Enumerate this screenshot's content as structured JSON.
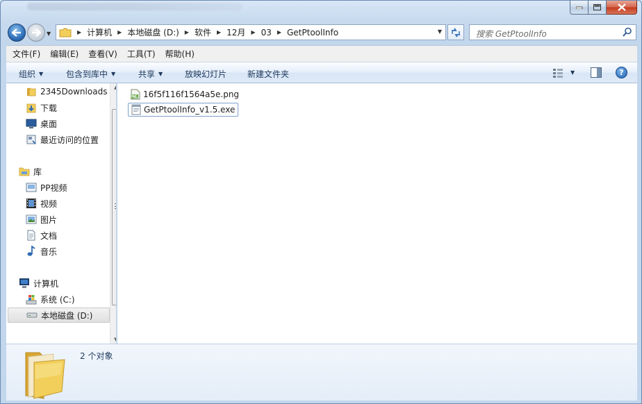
{
  "window": {
    "title_obscured": true
  },
  "address": {
    "breadcrumbs": [
      "计算机",
      "本地磁盘 (D:)",
      "软件",
      "12月",
      "03",
      "GetPtoolInfo"
    ],
    "search_placeholder": "搜索 GetPtoolInfo"
  },
  "menu": {
    "items": [
      "文件(F)",
      "编辑(E)",
      "查看(V)",
      "工具(T)",
      "帮助(H)"
    ]
  },
  "commands": {
    "organize": "组织",
    "include_in_library": "包含到库中",
    "share": "共享",
    "slideshow": "放映幻灯片",
    "new_folder": "新建文件夹"
  },
  "nav": {
    "items": [
      {
        "label": "2345Downloads",
        "icon": "folder-icon"
      },
      {
        "label": "下载",
        "icon": "downloads-icon"
      },
      {
        "label": "桌面",
        "icon": "desktop-icon"
      },
      {
        "label": "最近访问的位置",
        "icon": "recent-places-icon"
      },
      {
        "label": "库",
        "icon": "libraries-icon"
      },
      {
        "label": "PP视频",
        "icon": "pp-video-icon"
      },
      {
        "label": "视频",
        "icon": "video-icon"
      },
      {
        "label": "图片",
        "icon": "pictures-icon"
      },
      {
        "label": "文档",
        "icon": "documents-icon"
      },
      {
        "label": "音乐",
        "icon": "music-icon"
      },
      {
        "label": "计算机",
        "icon": "computer-icon"
      },
      {
        "label": "系统 (C:)",
        "icon": "system-drive-icon"
      },
      {
        "label": "本地磁盘 (D:)",
        "icon": "drive-icon"
      }
    ]
  },
  "files": [
    {
      "name": "16f5f116f1564a5e.png",
      "icon": "png-file-icon"
    },
    {
      "name": "GetPtoolInfo_v1.5.exe",
      "icon": "exe-file-icon"
    }
  ],
  "details": {
    "item_count": "2 个对象"
  },
  "colors": {
    "accent": "#1e395b",
    "selection_border": "#7da2ce",
    "folder_yellow": "#f2cf5b"
  }
}
